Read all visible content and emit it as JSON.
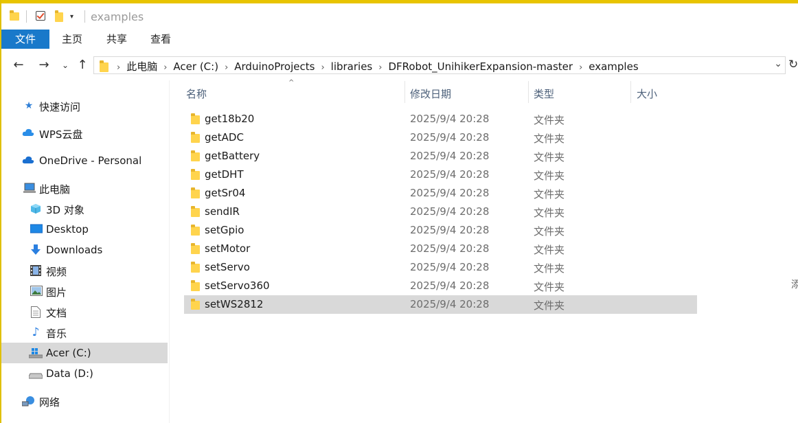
{
  "window": {
    "title": "examples"
  },
  "ribbon": {
    "tabs": [
      {
        "label": "文件"
      },
      {
        "label": "主页"
      },
      {
        "label": "共享"
      },
      {
        "label": "查看"
      }
    ]
  },
  "address": {
    "crumbs": [
      "此电脑",
      "Acer (C:)",
      "ArduinoProjects",
      "libraries",
      "DFRobot_UnihikerExpansion-master",
      "examples"
    ]
  },
  "nav_icons": {
    "back": "arrow-left-icon",
    "forward": "arrow-right-icon",
    "recent": "chevron-down-icon",
    "up": "arrow-up-icon",
    "refresh": "refresh-icon"
  },
  "sidebar": {
    "items": [
      {
        "label": "快速访问",
        "icon": "star-icon"
      },
      {
        "label": "WPS云盘",
        "icon": "cloud-icon"
      },
      {
        "label": "OneDrive - Personal",
        "icon": "cloud-icon"
      },
      {
        "label": "此电脑",
        "icon": "computer-icon"
      },
      {
        "label": "3D 对象",
        "icon": "cube-icon"
      },
      {
        "label": "Desktop",
        "icon": "desktop-icon"
      },
      {
        "label": "Downloads",
        "icon": "download-icon"
      },
      {
        "label": "视频",
        "icon": "video-icon"
      },
      {
        "label": "图片",
        "icon": "picture-icon"
      },
      {
        "label": "文档",
        "icon": "document-icon"
      },
      {
        "label": "音乐",
        "icon": "music-icon"
      },
      {
        "label": "Acer (C:)",
        "icon": "windows-drive-icon",
        "selected": true
      },
      {
        "label": "Data (D:)",
        "icon": "drive-icon"
      },
      {
        "label": "网络",
        "icon": "network-icon"
      }
    ]
  },
  "columns": {
    "name": "名称",
    "date": "修改日期",
    "type": "类型",
    "size": "大小"
  },
  "files": [
    {
      "name": "get18b20",
      "date": "2025/9/4 20:28",
      "type": "文件夹"
    },
    {
      "name": "getADC",
      "date": "2025/9/4 20:28",
      "type": "文件夹"
    },
    {
      "name": "getBattery",
      "date": "2025/9/4 20:28",
      "type": "文件夹"
    },
    {
      "name": "getDHT",
      "date": "2025/9/4 20:28",
      "type": "文件夹"
    },
    {
      "name": "getSr04",
      "date": "2025/9/4 20:28",
      "type": "文件夹"
    },
    {
      "name": "sendIR",
      "date": "2025/9/4 20:28",
      "type": "文件夹"
    },
    {
      "name": "setGpio",
      "date": "2025/9/4 20:28",
      "type": "文件夹"
    },
    {
      "name": "setMotor",
      "date": "2025/9/4 20:28",
      "type": "文件夹"
    },
    {
      "name": "setServo",
      "date": "2025/9/4 20:28",
      "type": "文件夹"
    },
    {
      "name": "setServo360",
      "date": "2025/9/4 20:28",
      "type": "文件夹"
    },
    {
      "name": "setWS2812",
      "date": "2025/9/4 20:28",
      "type": "文件夹",
      "selected": true
    }
  ],
  "edge": {
    "char": "添"
  },
  "colors": {
    "accent": "#1979ca",
    "folder": "#ffd44d",
    "selection": "#d9d9d9",
    "header_text": "#4c607a"
  }
}
